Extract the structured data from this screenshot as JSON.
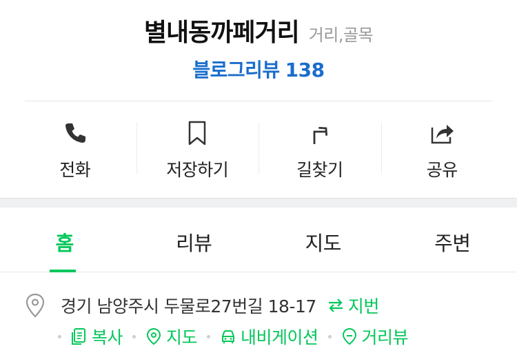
{
  "place": {
    "name": "별내동까페거리",
    "category": "거리,골목",
    "review_label": "블로그리뷰",
    "review_count": "138"
  },
  "actions": [
    {
      "label": "전화",
      "icon": "phone-icon"
    },
    {
      "label": "저장하기",
      "icon": "bookmark-icon"
    },
    {
      "label": "길찾기",
      "icon": "directions-icon"
    },
    {
      "label": "공유",
      "icon": "share-icon"
    }
  ],
  "tabs": [
    {
      "label": "홈",
      "active": true
    },
    {
      "label": "리뷰",
      "active": false
    },
    {
      "label": "지도",
      "active": false
    },
    {
      "label": "주변",
      "active": false
    }
  ],
  "address": {
    "text": "경기 남양주시 두물로27번길 18-17",
    "toggle_label": "지번",
    "links": [
      {
        "label": "복사",
        "icon": "copy-icon"
      },
      {
        "label": "지도",
        "icon": "map-pin-icon"
      },
      {
        "label": "내비게이션",
        "icon": "car-icon"
      },
      {
        "label": "거리뷰",
        "icon": "street-view-icon"
      }
    ]
  },
  "colors": {
    "accent_green": "#03c75a",
    "link_blue": "#1a6dcc"
  }
}
